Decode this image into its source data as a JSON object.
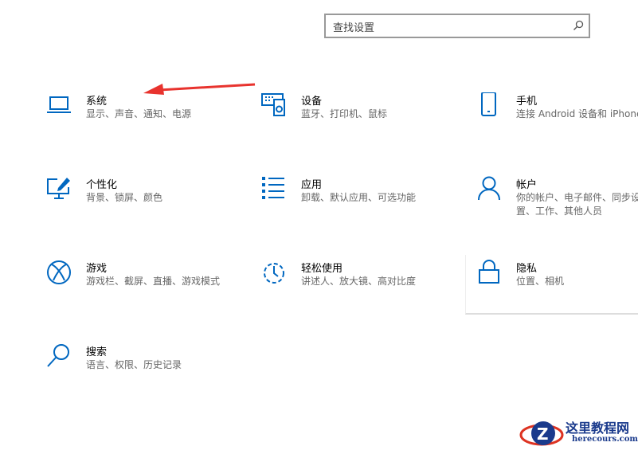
{
  "search": {
    "placeholder": "查找设置"
  },
  "tiles": [
    {
      "title": "系统",
      "subtitle": "显示、声音、通知、电源"
    },
    {
      "title": "设备",
      "subtitle": "蓝牙、打印机、鼠标"
    },
    {
      "title": "手机",
      "subtitle": "连接 Android 设备和 iPhone"
    },
    {
      "title": "个性化",
      "subtitle": "背景、锁屏、颜色"
    },
    {
      "title": "应用",
      "subtitle": "卸载、默认应用、可选功能"
    },
    {
      "title": "帐户",
      "subtitle": "你的帐户、电子邮件、同步设",
      "subtitle2": "置、工作、其他人员"
    },
    {
      "title": "游戏",
      "subtitle": "游戏栏、截屏、直播、游戏模式"
    },
    {
      "title": "轻松使用",
      "subtitle": "讲述人、放大镜、高对比度"
    },
    {
      "title": "隐私",
      "subtitle": "位置、相机"
    },
    {
      "title": "搜索",
      "subtitle": "语言、权限、历史记录"
    }
  ],
  "watermark": {
    "name": "这里教程网",
    "url": "herecours.com"
  },
  "colors": {
    "accent": "#0067c0",
    "arrow": "#e8332e"
  }
}
